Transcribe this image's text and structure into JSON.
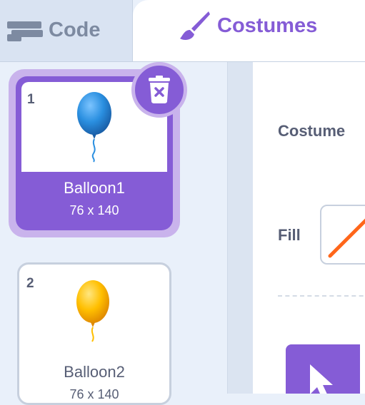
{
  "tabs": {
    "code_label": "Code",
    "costumes_label": "Costumes",
    "active": "Costumes"
  },
  "costumes": [
    {
      "number": "1",
      "name": "Balloon1",
      "dims": "76 x 140",
      "color": "#2a8fe0",
      "selected": true
    },
    {
      "number": "2",
      "name": "Balloon2",
      "dims": "76 x 140",
      "color": "#ffbf00",
      "selected": false
    }
  ],
  "editor": {
    "costume_field_label": "Costume",
    "fill_label": "Fill"
  },
  "colors": {
    "accent": "#855cd6",
    "text": "#575e75",
    "sidebar_bg": "#e9f0fa",
    "fill_swatch": "#ff661a"
  }
}
